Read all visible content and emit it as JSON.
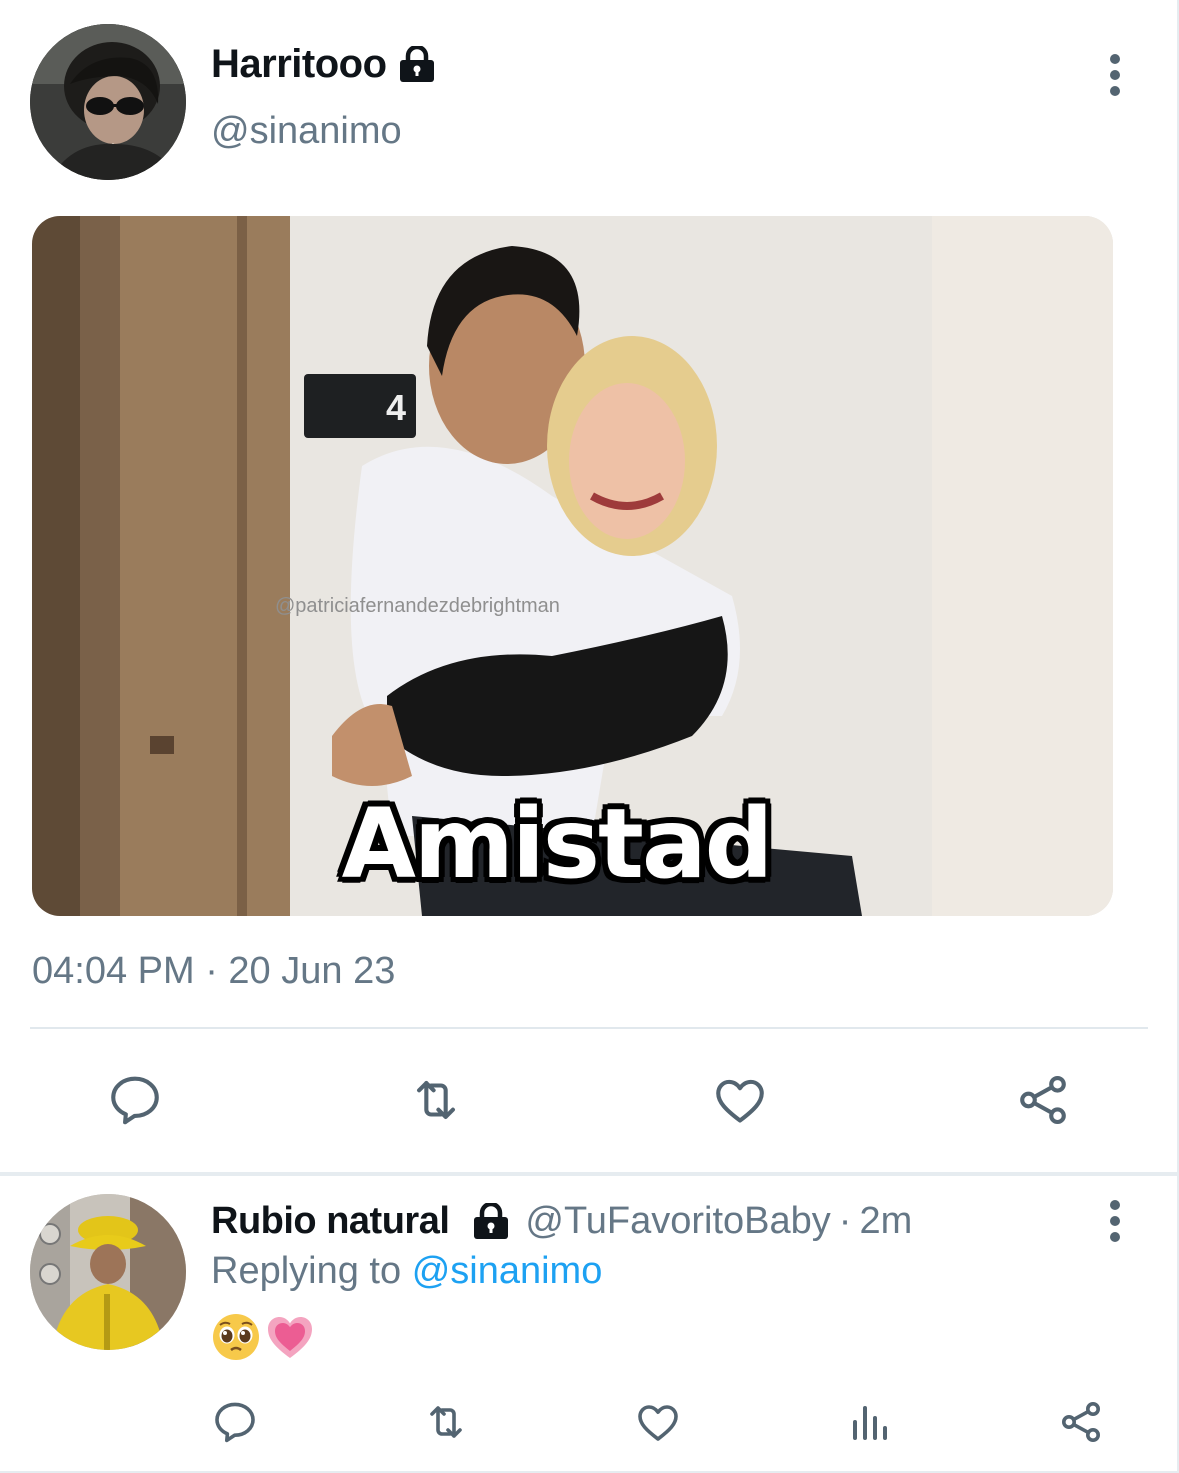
{
  "tweet": {
    "display_name": "Harritooo",
    "handle": "@sinanimo",
    "image_caption": "Amistad",
    "image_watermark": "@patriciafernandezdebrightman",
    "image_door_sign": "4",
    "timestamp": "04:04 PM · 20 Jun 23",
    "icons": {
      "protected": "lock-icon",
      "more": "more-vertical-icon",
      "reply": "reply-icon",
      "retweet": "retweet-icon",
      "like": "heart-icon",
      "share": "share-icon"
    }
  },
  "reply": {
    "display_name": "Rubio natural",
    "handle": "@TuFavoritoBaby",
    "separator": "·",
    "time": "2m",
    "replying_prefix": "Replying to",
    "replying_mention": "@sinanimo",
    "emoji_text": "🥺💗",
    "icons": {
      "protected": "lock-icon",
      "more": "more-vertical-icon",
      "reply": "reply-icon",
      "retweet": "retweet-icon",
      "like": "heart-icon",
      "analytics": "analytics-icon",
      "share": "share-icon"
    }
  },
  "colors": {
    "text_primary": "#0f1419",
    "text_secondary": "#657786",
    "link": "#1da1f2",
    "divider": "#e1e8ed"
  }
}
